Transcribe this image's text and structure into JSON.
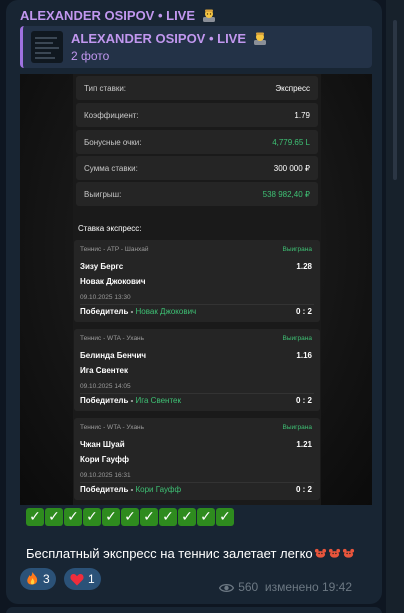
{
  "post": {
    "channel_name": "ALEXANDER OSIPOV • LIVE",
    "reply": {
      "title": "ALEXANDER OSIPOV • LIVE",
      "subtitle": "2 фото"
    },
    "checks": [
      "✓",
      "✓",
      "✓",
      "✓",
      "✓",
      "✓",
      "✓",
      "✓",
      "✓",
      "✓",
      "✓"
    ],
    "text": "Бесплатный экспресс на теннис залетает легко",
    "reactions": [
      {
        "emoji": "fire-icon",
        "count": "3"
      },
      {
        "emoji": "heart-icon",
        "count": "1"
      }
    ],
    "views": "560",
    "edited_time": "изменено 19:42"
  },
  "bet_slip": {
    "rows": [
      {
        "label": "Тип ставки:",
        "value": "Экспресс",
        "color": "#ffffff"
      },
      {
        "label": "Коэффициент:",
        "value": "1.79",
        "color": "#ffffff"
      },
      {
        "label": "Бонусные очки:",
        "value": "4,779.65 L",
        "color": "#3ec074"
      },
      {
        "label": "Сумма ставки:",
        "value": "300 000 ₽",
        "color": "#ffffff"
      },
      {
        "label": "Выигрыш:",
        "value": "538 982,40 ₽",
        "color": "#3ec074"
      }
    ],
    "section_title": "Ставка экспресс:",
    "matches": [
      {
        "tournament": "Теннис - ATP - Шанхай",
        "status": "Выиграна",
        "player1": "Зизу Бергс",
        "player2": "Новак Джокович",
        "coef": "1.28",
        "date": "09.10.2025 13:30",
        "winner_label": "Победитель - ",
        "winner_pick": "Новак Джокович",
        "score": "0 : 2"
      },
      {
        "tournament": "Теннис - WTA - Ухань",
        "status": "Выиграна",
        "player1": "Белинда Бенчич",
        "player2": "Ига Свентек",
        "coef": "1.16",
        "date": "09.10.2025 14:05",
        "winner_label": "Победитель - ",
        "winner_pick": "Ига Свентек",
        "score": "0 : 2"
      },
      {
        "tournament": "Теннис - WTA - Ухань",
        "status": "Выиграна",
        "player1": "Чжан Шуай",
        "player2": "Кори Гауфф",
        "coef": "1.21",
        "date": "09.10.2025 16:31",
        "winner_label": "Победитель - ",
        "winner_pick": "Кори Гауфф",
        "score": "0 : 2"
      }
    ]
  },
  "colors": {
    "accent_name": "#c197ef",
    "win_green": "#3ec074",
    "check_green": "#2e8b1e",
    "reaction_bg": "#2b5278"
  }
}
